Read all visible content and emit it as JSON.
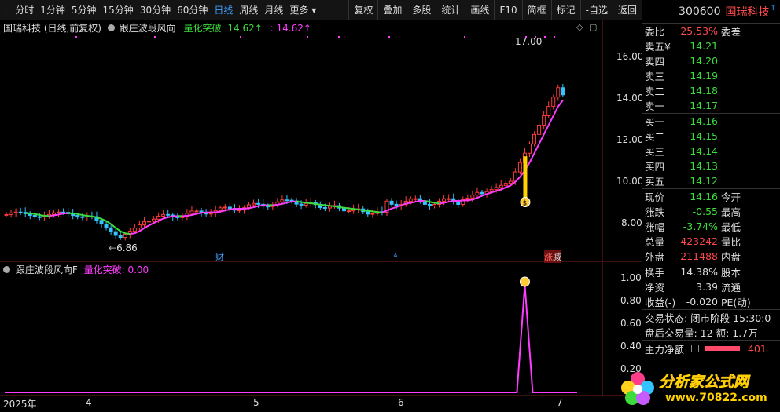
{
  "topbar": {
    "periods": [
      "分时",
      "1分钟",
      "5分钟",
      "15分钟",
      "30分钟",
      "60分钟",
      "日线",
      "周线",
      "月线",
      "更多 ▾"
    ],
    "active_period": "日线",
    "buttons": [
      "复权",
      "叠加",
      "多股",
      "统计",
      "画线",
      "F10",
      "简框",
      "标记",
      "-自选",
      "返回"
    ]
  },
  "main_panel": {
    "stock_title": "国瑞科技 (日线,前复权)",
    "indicator_name": "跟庄波段风向",
    "signal_label": "量化突破:",
    "signal_value": "14.62↑",
    "signal_extra": ": 14.62↑",
    "price_axis": [
      "16.00",
      "14.00",
      "12.00",
      "10.00",
      "8.00"
    ],
    "high_label": "17.00",
    "low_label": "6.86",
    "markers": {
      "cai": "财",
      "zhang": "涨",
      "jian": "减"
    }
  },
  "sub_panel": {
    "indicator_name": "跟庄波段风向F",
    "signal_label": "量化突破:",
    "signal_value": "0.00",
    "axis": [
      "1.00",
      "0.80",
      "0.60",
      "0.40",
      "0.20"
    ]
  },
  "x_axis": {
    "labels": [
      "2025年",
      "4",
      "5",
      "6",
      "7"
    ]
  },
  "quote": {
    "code": "300600",
    "name": "国瑞科技",
    "weibi_label": "委比",
    "weibi_value": "25.53%",
    "weicha_label": "委差",
    "sell": [
      {
        "label": "卖五",
        "price": "14.21",
        "mark": "¥"
      },
      {
        "label": "卖四",
        "price": "14.20",
        "mark": ""
      },
      {
        "label": "卖三",
        "price": "14.19",
        "mark": ""
      },
      {
        "label": "卖二",
        "price": "14.18",
        "mark": ""
      },
      {
        "label": "卖一",
        "price": "14.17",
        "mark": ""
      }
    ],
    "buy": [
      {
        "label": "买一",
        "price": "14.16"
      },
      {
        "label": "买二",
        "price": "14.15"
      },
      {
        "label": "买三",
        "price": "14.14"
      },
      {
        "label": "买四",
        "price": "14.13"
      },
      {
        "label": "买五",
        "price": "14.12"
      }
    ],
    "stats": [
      {
        "label": "现价",
        "value": "14.16",
        "color": "#3ddc3d",
        "label2": "今开"
      },
      {
        "label": "涨跌",
        "value": "-0.55",
        "color": "#3ddc3d",
        "label2": "最高"
      },
      {
        "label": "涨幅",
        "value": "-3.74%",
        "color": "#3ddc3d",
        "label2": "最低"
      },
      {
        "label": "总量",
        "value": "423242",
        "color": "#ff4a4a",
        "label2": "量比"
      },
      {
        "label": "外盘",
        "value": "211488",
        "color": "#ff4a4a",
        "label2": "内盘"
      }
    ],
    "stats2": [
      {
        "label": "换手",
        "value": "14.38%",
        "label2": "股本"
      },
      {
        "label": "净资",
        "value": "3.39",
        "label2": "流通"
      },
      {
        "label": "收益(-)",
        "value": "-0.020",
        "label2": "PE(动)"
      }
    ],
    "trade_state": "交易状态: 闭市阶段  15:30:0",
    "after_hours": "盘后交易量: 12  额: 1.7万",
    "main_net_label": "主力净额",
    "main_net_value": "401"
  },
  "watermark": {
    "title": "分析家公式网",
    "url": "www.70822.com"
  }
}
